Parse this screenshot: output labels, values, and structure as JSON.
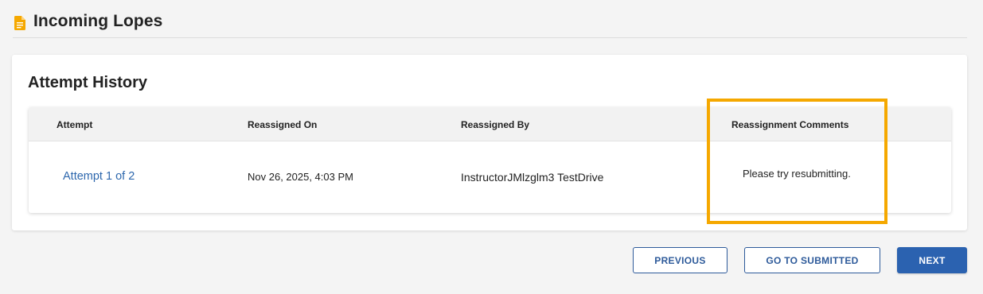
{
  "header": {
    "title": "Incoming Lopes",
    "icon": "document-icon",
    "icon_color": "#f5a800"
  },
  "card": {
    "title": "Attempt History"
  },
  "table": {
    "columns": [
      "Attempt",
      "Reassigned On",
      "Reassigned By",
      "Reassignment Comments"
    ],
    "rows": [
      {
        "attempt": "Attempt 1 of 2",
        "reassigned_on": "Nov 26, 2025, 4:03 PM",
        "reassigned_by": "InstructorJMlzglm3 TestDrive",
        "comment": "Please try resubmitting."
      }
    ]
  },
  "highlight_color": "#f5a800",
  "buttons": {
    "previous": "PREVIOUS",
    "go_to_submitted": "GO TO SUBMITTED",
    "next": "NEXT"
  },
  "colors": {
    "primary": "#2b62b0",
    "link": "#2d67ad",
    "background": "#f4f4f4"
  }
}
